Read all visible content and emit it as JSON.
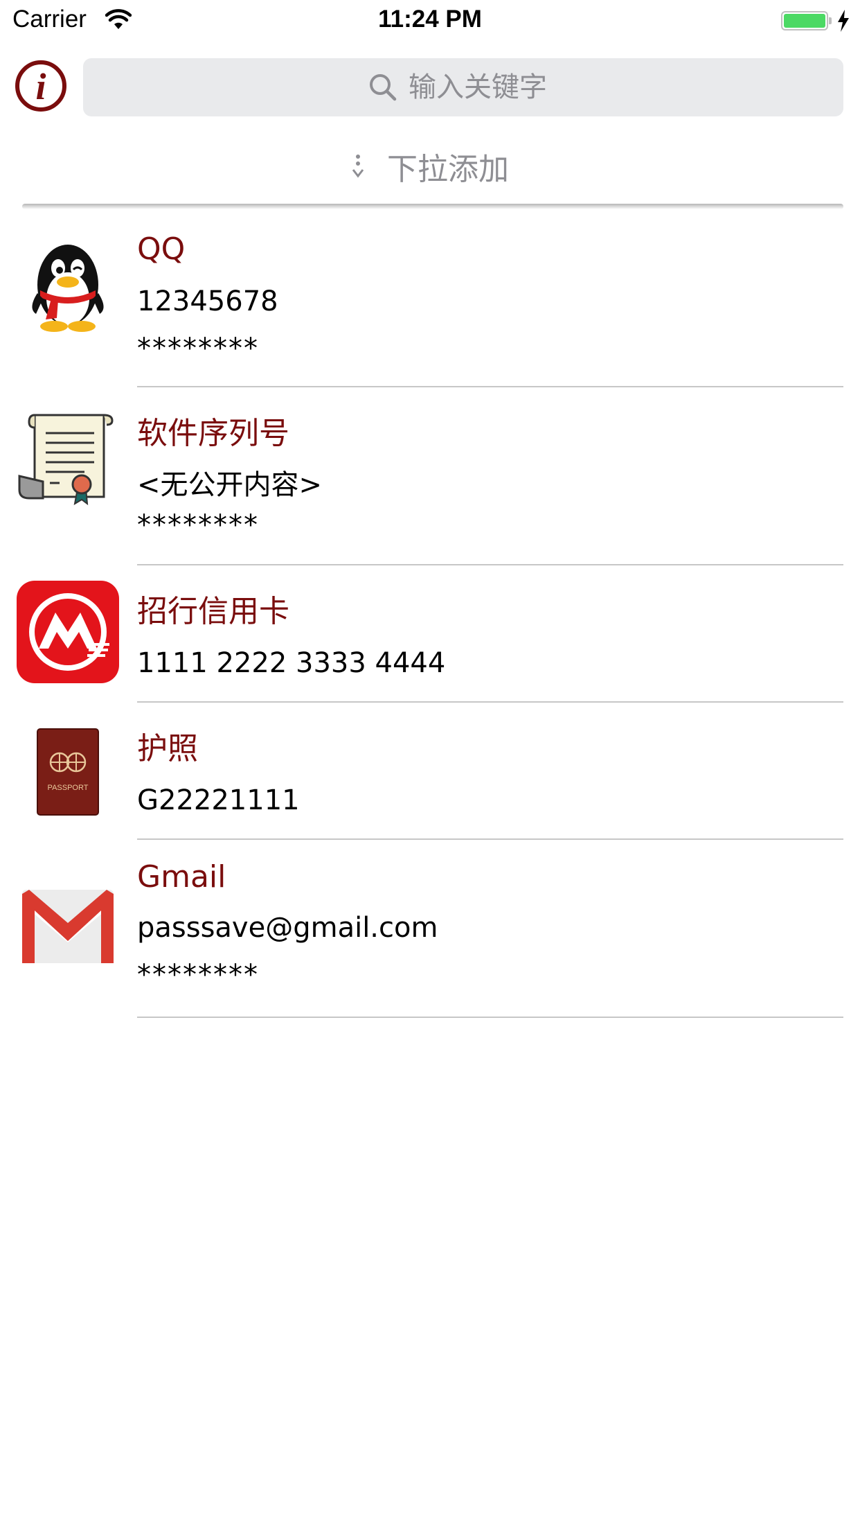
{
  "status_bar": {
    "carrier": "Carrier",
    "time": "11:24 PM",
    "battery_color": "#4cd964"
  },
  "toolbar": {
    "info_icon": "i",
    "search_placeholder": "输入关键字"
  },
  "pull_hint": "下拉添加",
  "accent_color": "#7a0d0d",
  "entries": [
    {
      "title": "QQ",
      "line1": "12345678",
      "line2": "********",
      "icon": "qq-penguin-icon"
    },
    {
      "title": "软件序列号",
      "line1": "<无公开内容>",
      "line2": "********",
      "icon": "scroll-certificate-icon"
    },
    {
      "title": "招行信用卡",
      "line1": "1111 2222 3333 4444",
      "line2": "",
      "icon": "cmb-bank-icon"
    },
    {
      "title": "护照",
      "line1": "G22221111",
      "line2": "",
      "icon": "passport-icon",
      "icon_text": "PASSPORT"
    },
    {
      "title": "Gmail",
      "line1": "passsave@gmail.com",
      "line2": "********",
      "icon": "gmail-icon"
    }
  ]
}
